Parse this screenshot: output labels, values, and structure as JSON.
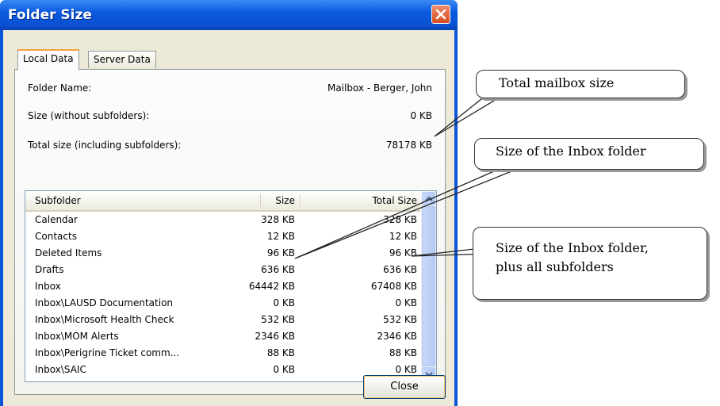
{
  "window": {
    "title": "Folder Size"
  },
  "tabs": [
    {
      "label": "Local Data",
      "active": true
    },
    {
      "label": "Server Data",
      "active": false
    }
  ],
  "info": {
    "folder_name_label": "Folder Name:",
    "folder_name_value": "Mailbox - Berger, John",
    "size_label": "Size (without subfolders):",
    "size_value": "0 KB",
    "total_label": "Total size (including subfolders):",
    "total_value": "78178 KB"
  },
  "list": {
    "columns": [
      "Subfolder",
      "Size",
      "Total Size"
    ],
    "rows": [
      [
        "Calendar",
        "328 KB",
        "328 KB"
      ],
      [
        "Contacts",
        "12 KB",
        "12 KB"
      ],
      [
        "Deleted Items",
        "96 KB",
        "96 KB"
      ],
      [
        "Drafts",
        "636 KB",
        "636 KB"
      ],
      [
        "Inbox",
        "64442 KB",
        "67408 KB"
      ],
      [
        "Inbox\\LAUSD Documentation",
        "0 KB",
        "0 KB"
      ],
      [
        "Inbox\\Microsoft Health Check",
        "532 KB",
        "532 KB"
      ],
      [
        "Inbox\\MOM Alerts",
        "2346 KB",
        "2346 KB"
      ],
      [
        "Inbox\\Perigrine Ticket comm...",
        "88 KB",
        "88 KB"
      ],
      [
        "Inbox\\SAIC",
        "0 KB",
        "0 KB"
      ]
    ]
  },
  "buttons": {
    "close_label": "Close"
  },
  "callouts": {
    "total_mailbox": "Total mailbox size",
    "inbox_size": "Size of the Inbox folder",
    "inbox_plus_line1": "Size of the Inbox folder,",
    "inbox_plus_line2": "plus all subfolders"
  },
  "icons": {
    "close": "close-icon",
    "scroll_up": "chevron-up-icon",
    "scroll_down": "chevron-down-icon"
  },
  "colors": {
    "titlebar": "#0a56d8",
    "close_button": "#d84a1e",
    "dialog_bg": "#ece9d8",
    "tab_highlight": "#f3a33c"
  }
}
